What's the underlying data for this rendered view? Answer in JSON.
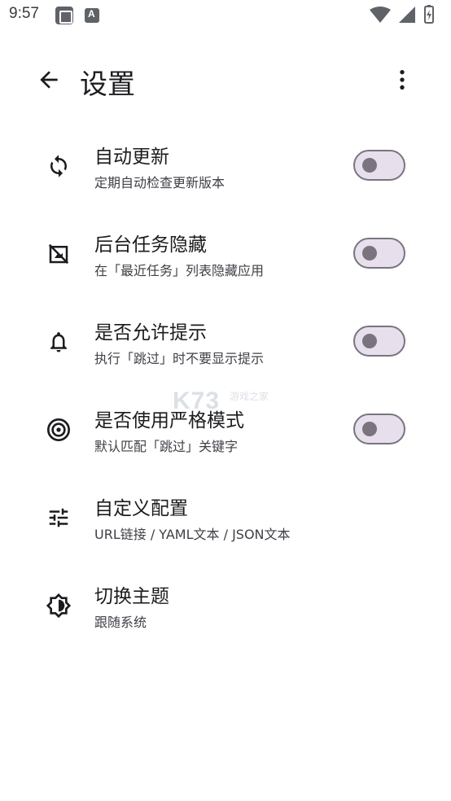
{
  "status_bar": {
    "time": "9:57",
    "icons": [
      "app-notification-icon",
      "font-notification-icon",
      "wifi-icon",
      "signal-icon",
      "battery-icon"
    ]
  },
  "app_bar": {
    "title": "设置",
    "back_icon": "arrow-back-icon",
    "overflow_icon": "more-vert-icon"
  },
  "settings": [
    {
      "icon": "sync-icon",
      "title": "自动更新",
      "subtitle": "定期自动检查更新版本",
      "has_switch": true,
      "switch_on": false
    },
    {
      "icon": "hide-recents-icon",
      "title": "后台任务隐藏",
      "subtitle": "在「最近任务」列表隐藏应用",
      "has_switch": true,
      "switch_on": false
    },
    {
      "icon": "bell-icon",
      "title": "是否允许提示",
      "subtitle": "执行「跳过」时不要显示提示",
      "has_switch": true,
      "switch_on": false
    },
    {
      "icon": "target-icon",
      "title": "是否使用严格模式",
      "subtitle": "默认匹配「跳过」关键字",
      "has_switch": true,
      "switch_on": false
    },
    {
      "icon": "tune-icon",
      "title": "自定义配置",
      "subtitle": "URL链接 / YAML文本 / JSON文本",
      "has_switch": false
    },
    {
      "icon": "theme-brightness-icon",
      "title": "切换主题",
      "subtitle": "跟随系统",
      "has_switch": false
    }
  ],
  "watermark": {
    "main": "K73",
    "sub": "游戏之家"
  },
  "colors": {
    "switch_track": "#e7e0ec",
    "switch_border": "#79747e",
    "text_primary": "#1c1b1f",
    "text_secondary": "#3f3f46"
  }
}
